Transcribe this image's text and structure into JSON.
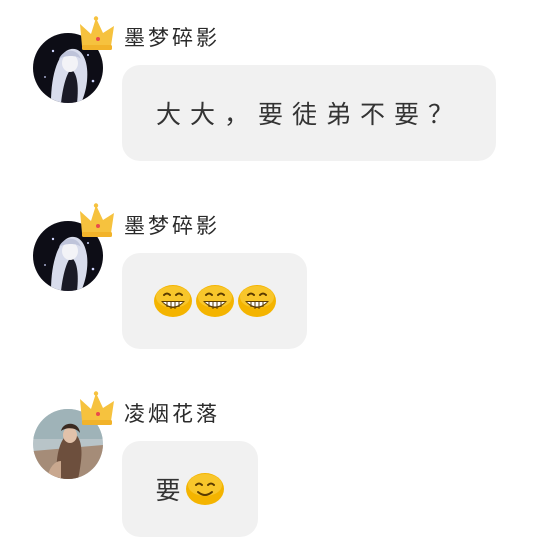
{
  "messages": [
    {
      "sender": "墨梦碎影",
      "avatar_icon": "dark-anime-girl-avatar",
      "badge_icon": "crown-icon",
      "text": "大大，要徒弟不要？",
      "emojis": []
    },
    {
      "sender": "墨梦碎影",
      "avatar_icon": "dark-anime-girl-avatar",
      "badge_icon": "crown-icon",
      "text": "",
      "emojis": [
        "grinning-face-icon",
        "grinning-face-icon",
        "grinning-face-icon"
      ]
    },
    {
      "sender": "凌烟花落",
      "avatar_icon": "photo-girl-avatar",
      "badge_icon": "crown-icon",
      "text": "要",
      "emojis": [
        "smiling-face-icon"
      ]
    }
  ],
  "colors": {
    "bubble_bg": "#f1f1f1",
    "crown": "#f6c23e",
    "emoji_face": "#f4b400"
  }
}
